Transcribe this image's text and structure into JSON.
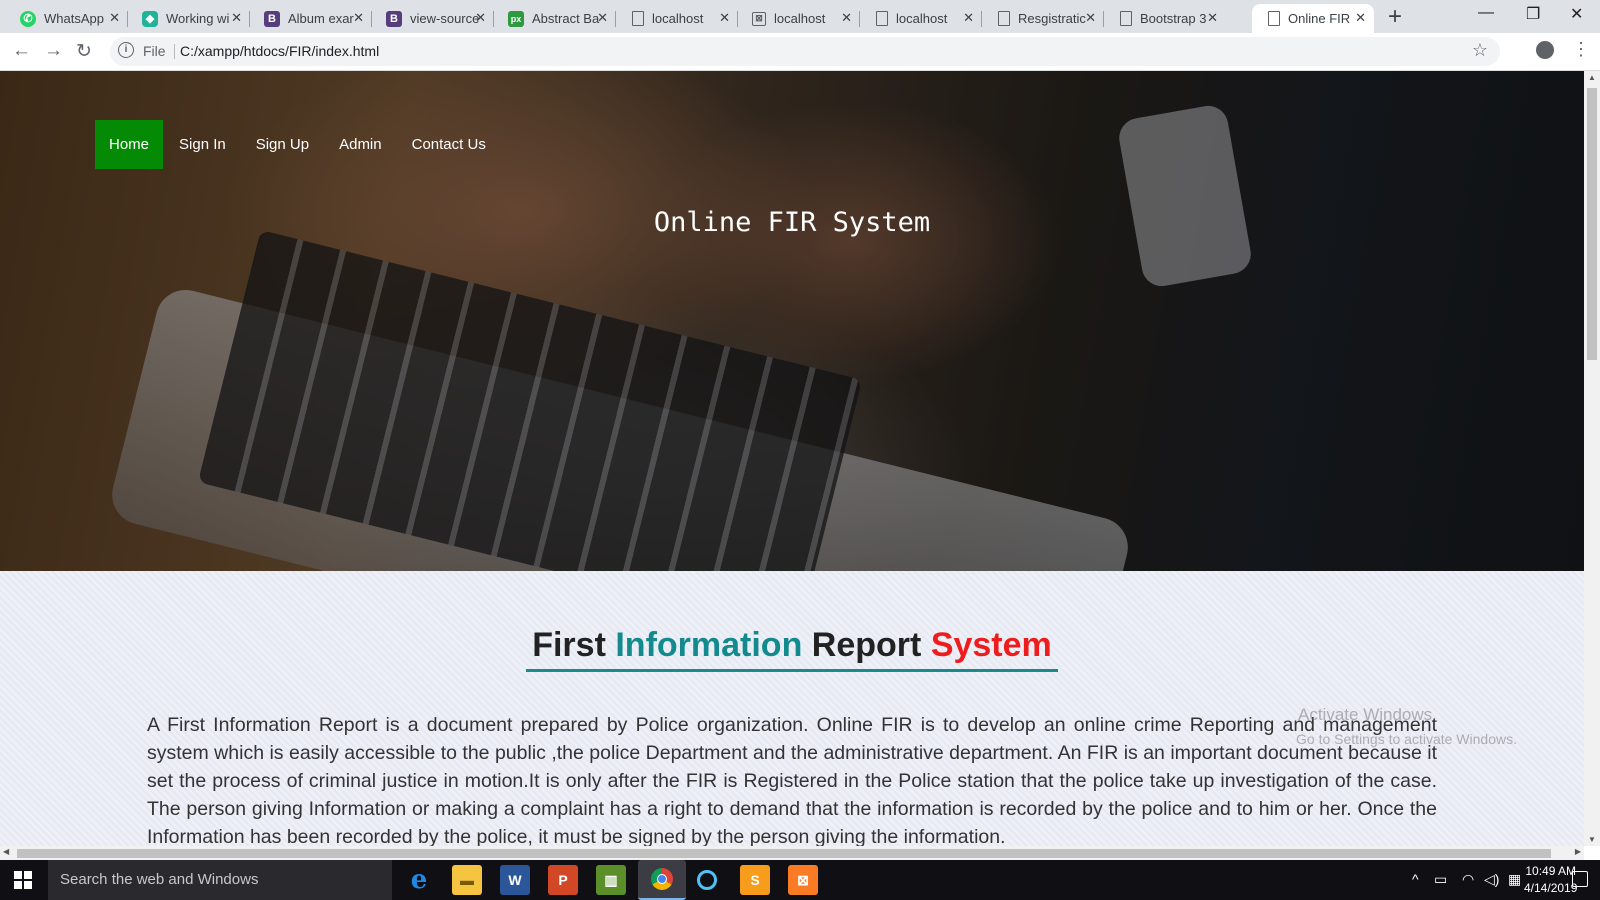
{
  "browser": {
    "tabs": [
      {
        "title": "WhatsApp",
        "icon": "whatsapp-icon",
        "color": "#25d366"
      },
      {
        "title": "Working wi",
        "icon": "shield-icon",
        "color": "#1fb398"
      },
      {
        "title": "Album exar",
        "icon": "bootstrap-icon",
        "color": "#563d7c"
      },
      {
        "title": "view-source",
        "icon": "bootstrap-icon",
        "color": "#563d7c"
      },
      {
        "title": "Abstract Ba",
        "icon": "px-icon",
        "color": "#2e9a3f"
      },
      {
        "title": "localhost",
        "icon": "page-icon",
        "color": "#5f6368"
      },
      {
        "title": "localhost",
        "icon": "image-icon",
        "color": "#5f6368"
      },
      {
        "title": "localhost",
        "icon": "page-icon",
        "color": "#5f6368"
      },
      {
        "title": "Resgistratic",
        "icon": "page-icon",
        "color": "#5f6368"
      },
      {
        "title": "Bootstrap 3",
        "icon": "page-icon",
        "color": "#5f6368"
      },
      {
        "title": "Online FIR",
        "icon": "page-icon",
        "color": "#5f6368",
        "active": true
      }
    ],
    "address": {
      "scheme_label": "File",
      "url": "C:/xampp/htdocs/FIR/index.html"
    }
  },
  "page": {
    "nav": {
      "home": "Home",
      "signin": "Sign In",
      "signup": "Sign Up",
      "admin": "Admin",
      "contact": "Contact Us"
    },
    "hero_title": "Online FIR System",
    "heading": {
      "w1": "First",
      "w2": "Information",
      "w3": "Report",
      "w4": "System"
    },
    "paragraph": "A First Information Report is a document prepared by Police organization. Online FIR is to develop an online crime Reporting and management system which is easily accessible to the public ,the police Department and the administrative department. An FIR is an important document because it set the process of criminal justice in motion.It is only after the FIR is Registered in the Police station that the police take up investigation of the case. The person giving Information or making a complaint has a right to demand that the information is recorded by the police and to him or her. Once the Information has been recorded by the police, it must be signed by the person giving the information."
  },
  "watermark": {
    "line1": "Activate Windows",
    "line2": "Go to Settings to activate Windows."
  },
  "taskbar": {
    "search_placeholder": "Search the web and Windows",
    "time": "10:49 AM",
    "date": "4/14/2019"
  },
  "colors": {
    "nav_active": "#058a05",
    "heading_teal": "#138a8e",
    "heading_red": "#ee1c1c"
  }
}
